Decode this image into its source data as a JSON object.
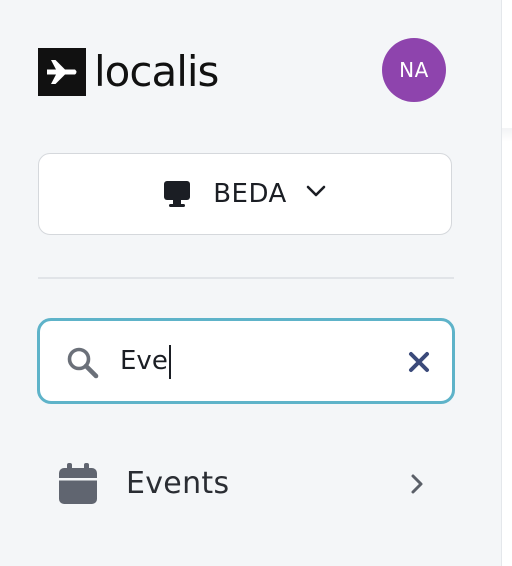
{
  "header": {
    "logo_text": "localis",
    "avatar_initials": "NA",
    "avatar_color": "#8e44ad"
  },
  "workspace": {
    "icon": "monitor-icon",
    "label": "BEDA",
    "chevron": "chevron-down-icon"
  },
  "search": {
    "icon": "search-icon",
    "value": "Eve",
    "clear_icon": "close-icon",
    "border_color": "#5eb3c9"
  },
  "menu": {
    "items": [
      {
        "icon": "calendar-icon",
        "label": "Events",
        "chevron": "chevron-right-icon"
      }
    ]
  }
}
